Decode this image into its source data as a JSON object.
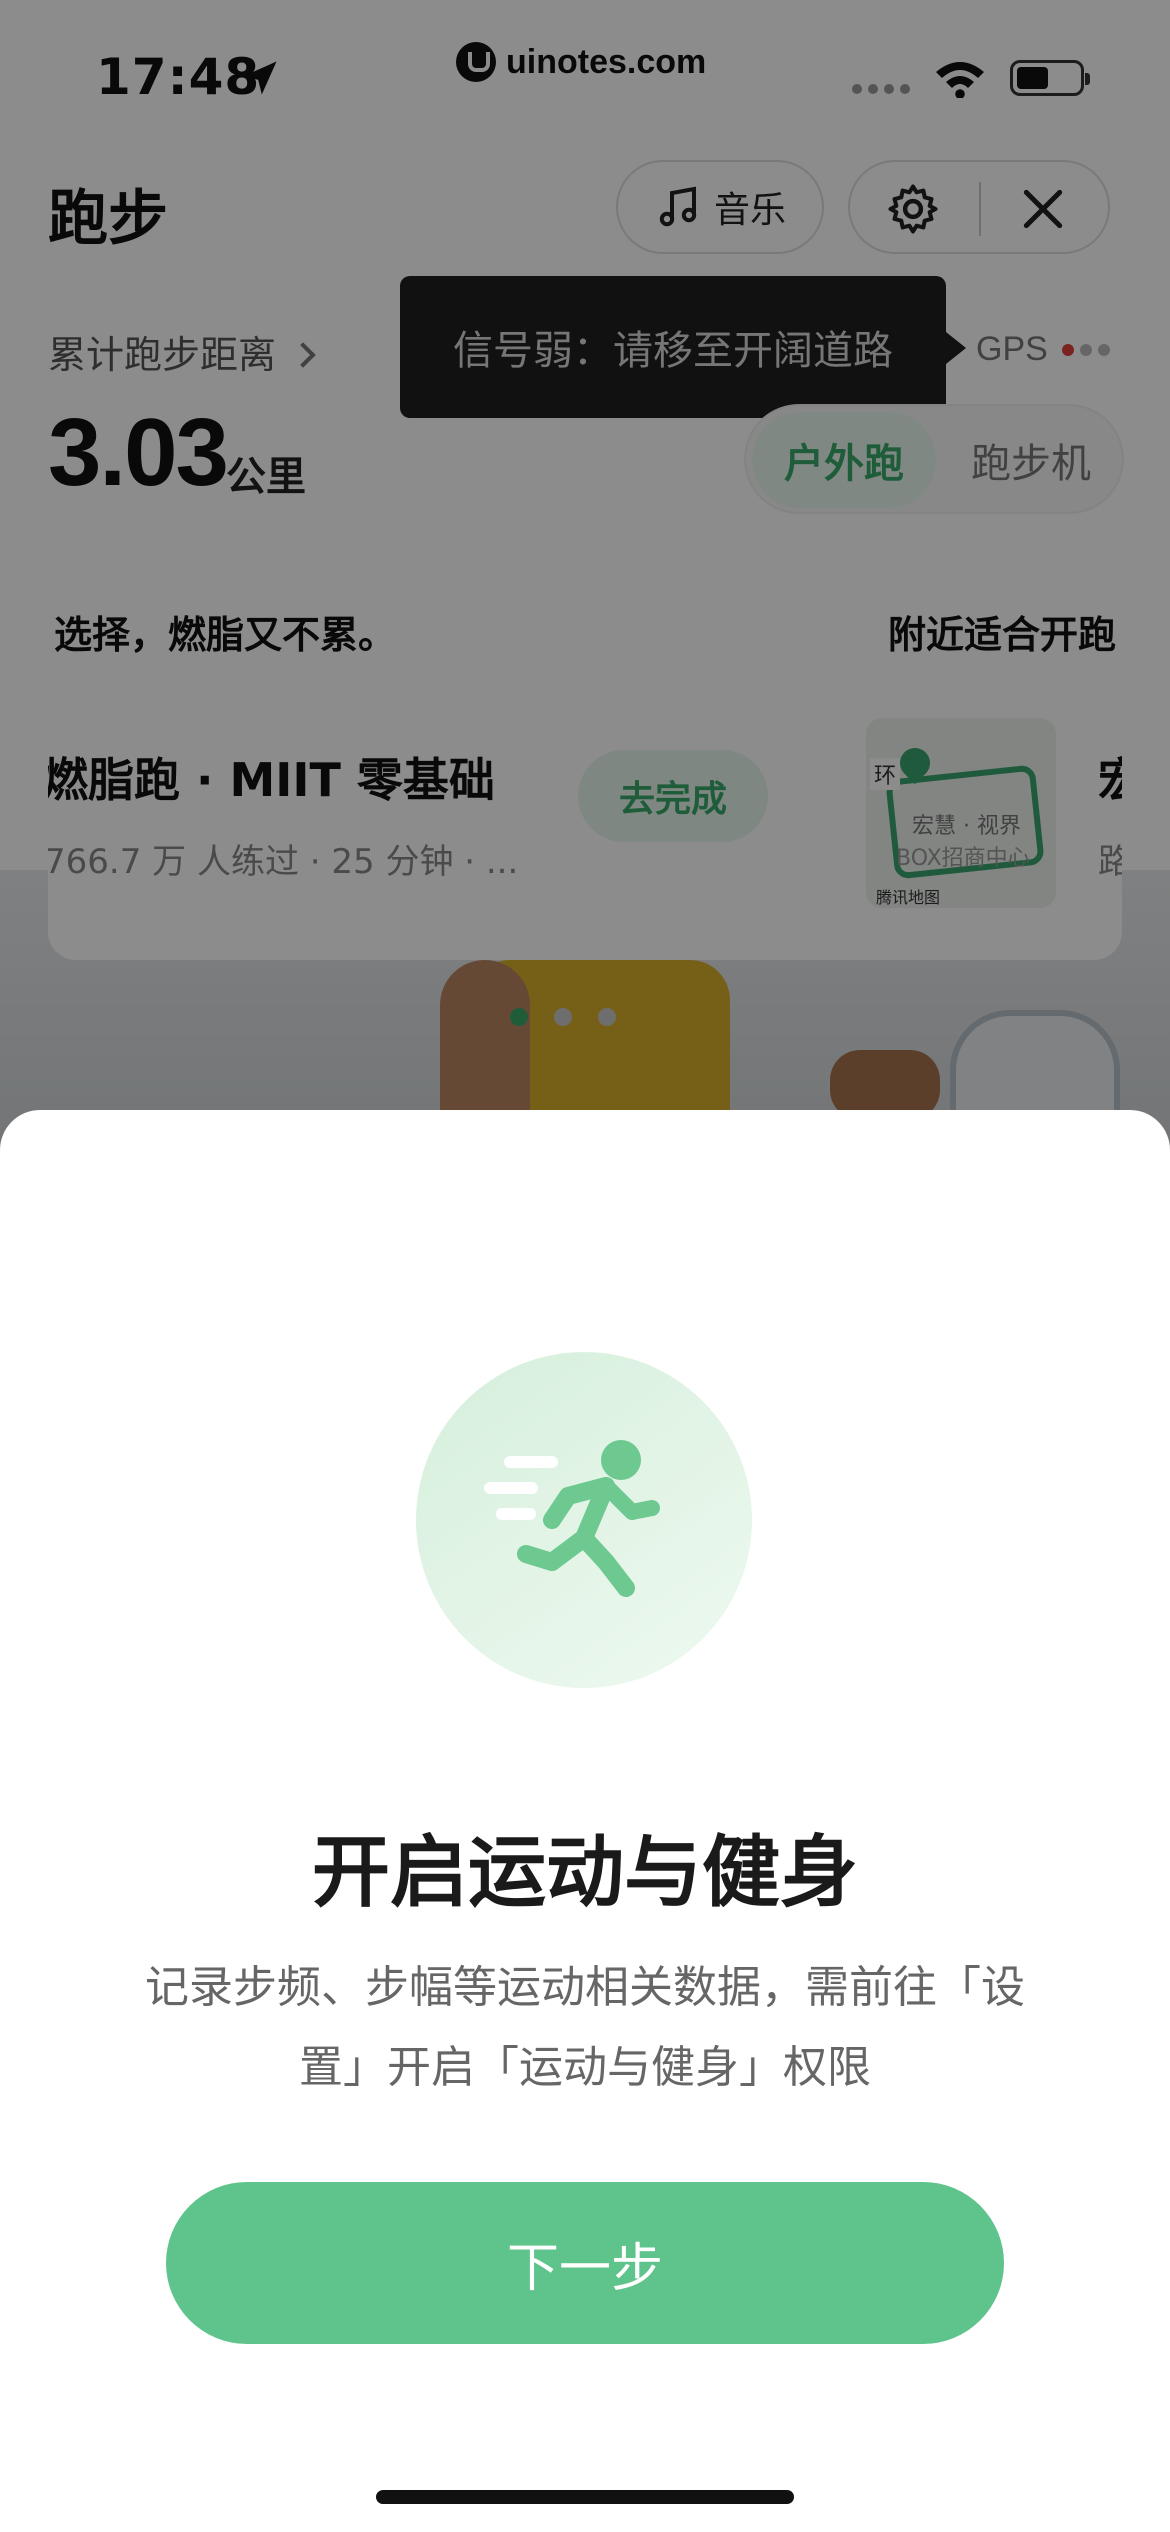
{
  "status_bar": {
    "time": "17:48",
    "watermark": "uinotes.com"
  },
  "header": {
    "title": "跑步",
    "music_label": "音乐"
  },
  "stats": {
    "distance_link": "累计跑步距离",
    "distance_value": "3.03",
    "distance_unit": "公里"
  },
  "gps": {
    "tooltip": "信号弱：请移至开阔道路",
    "label": "GPS"
  },
  "mode_toggle": {
    "outdoor": "户外跑",
    "treadmill": "跑步机"
  },
  "card": {
    "headline_left": "选择，燃脂又不累。",
    "headline_right": "附近适合开跑",
    "course_title": "燃脂跑 · MIIT 零基础",
    "course_meta": "766.7 万 人练过 · 25 分钟 · ...",
    "action": "去完成",
    "map_ring_label": "环",
    "map_label_1": "宏慧 · 视界",
    "map_label_2": "BOX招商中心",
    "map_brand": "腾讯地图",
    "peek_title": "宏",
    "peek_meta": "路"
  },
  "sheet": {
    "title": "开启运动与健身",
    "description": "记录步频、步幅等运动相关数据，需前往「设置」开启「运动与健身」权限",
    "next_button": "下一步"
  },
  "colors": {
    "accent": "#5fc48b",
    "accent_text": "#3aa86b",
    "tooltip_bg": "#1f1f1f"
  }
}
